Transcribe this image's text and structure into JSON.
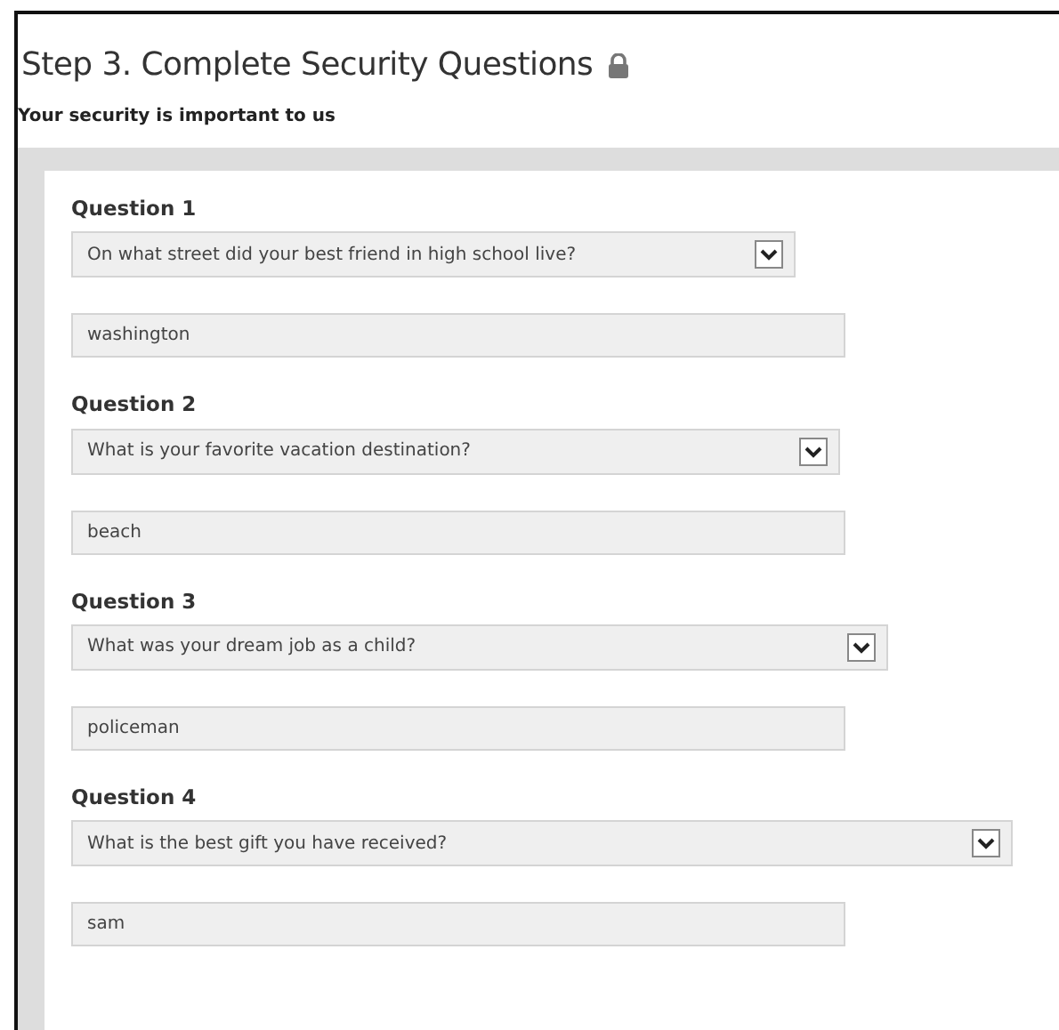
{
  "heading": {
    "title": "Step 3. Complete Security Questions",
    "subtitle": "Your security is important to us"
  },
  "questions": [
    {
      "label": "Question 1",
      "question": "On what street did your best friend in high school live?",
      "answer": "washington"
    },
    {
      "label": "Question 2",
      "question": "What is your favorite vacation destination?",
      "answer": "beach"
    },
    {
      "label": "Question 3",
      "question": "What was your dream job as a child?",
      "answer": "policeman"
    },
    {
      "label": "Question 4",
      "question": "What is the best gift you have received?",
      "answer": "sam"
    }
  ]
}
